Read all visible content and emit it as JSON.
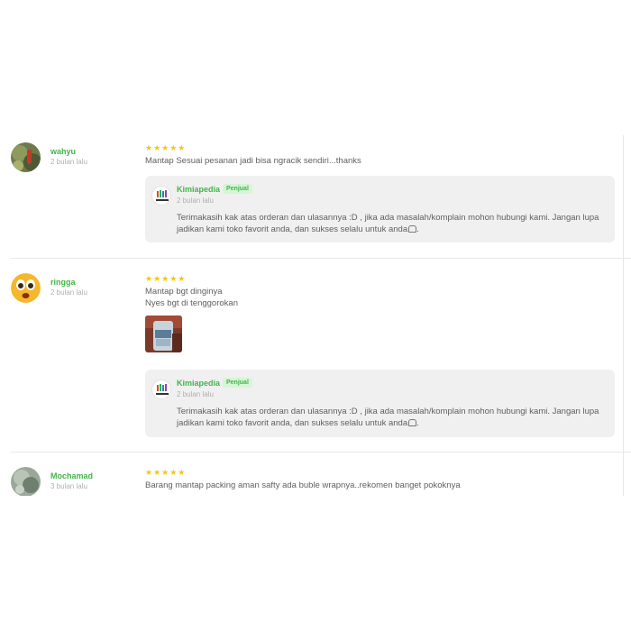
{
  "reviews": [
    {
      "user": "wahyu",
      "time": "2 bulan lalu",
      "stars": "★★★★★",
      "lines": [
        "Mantap Sesuai pesanan jadi bisa ngracik sendiri...thanks"
      ],
      "reply": {
        "shop": "Kimiapedia",
        "badge": "Penjual",
        "time": "2 bulan lalu",
        "text": "Terimakasih kak atas orderan dan ulasannya :D , jika ada masalah/komplain mohon hubungi kami. Jangan lupa jadikan kami toko favorit anda, dan sukses selalu untuk anda"
      }
    },
    {
      "user": "ringga",
      "time": "2 bulan lalu",
      "stars": "★★★★★",
      "lines": [
        "Mantap bgt dinginya",
        "Nyes bgt di tenggorokan"
      ],
      "reply": {
        "shop": "Kimiapedia",
        "badge": "Penjual",
        "time": "2 bulan lalu",
        "text": "Terimakasih kak atas orderan dan ulasannya :D , jika ada masalah/komplain mohon hubungi kami. Jangan lupa jadikan kami toko favorit anda, dan sukses selalu untuk anda"
      }
    },
    {
      "user": "Mochamad",
      "time": "3 bulan lalu",
      "stars": "★★★★★",
      "lines": [
        "Barang mantap packing aman safty ada buble wrapnya..rekomen banget pokoknya"
      ]
    }
  ],
  "icons": {
    "stars": "star-icon",
    "reply_emoji": "emoji-icon"
  },
  "colors": {
    "accent": "#42b549",
    "star": "#ffc400",
    "badge_bg": "#d7f5d7",
    "reply_bg": "#f0f0f0"
  }
}
